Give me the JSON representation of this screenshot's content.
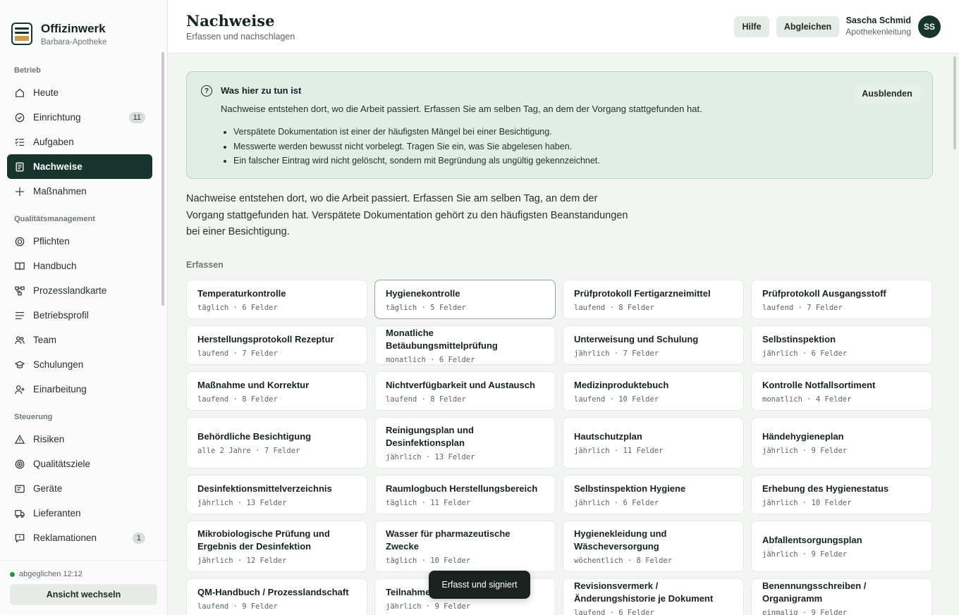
{
  "brand": {
    "name": "Offizinwerk",
    "pharmacy": "Barbara-Apotheke"
  },
  "nav": {
    "sections": [
      {
        "label": "Betrieb",
        "items": [
          {
            "label": "Heute",
            "icon": "home-icon"
          },
          {
            "label": "Einrichtung",
            "icon": "check-circle-icon",
            "badge": "11"
          },
          {
            "label": "Aufgaben",
            "icon": "checklist-icon"
          },
          {
            "label": "Nachweise",
            "icon": "document-icon",
            "active": true
          },
          {
            "label": "Maßnahmen",
            "icon": "plus-icon"
          }
        ]
      },
      {
        "label": "Qualitätsmanagement",
        "items": [
          {
            "label": "Pflichten",
            "icon": "target-icon"
          },
          {
            "label": "Handbuch",
            "icon": "book-icon"
          },
          {
            "label": "Prozesslandkarte",
            "icon": "flow-icon"
          },
          {
            "label": "Betriebsprofil",
            "icon": "lines-icon"
          },
          {
            "label": "Team",
            "icon": "users-icon"
          },
          {
            "label": "Schulungen",
            "icon": "graduation-cap-icon"
          },
          {
            "label": "Einarbeitung",
            "icon": "user-plus-icon"
          }
        ]
      },
      {
        "label": "Steuerung",
        "items": [
          {
            "label": "Risiken",
            "icon": "warning-icon"
          },
          {
            "label": "Qualitätsziele",
            "icon": "goal-icon"
          },
          {
            "label": "Geräte",
            "icon": "device-icon"
          },
          {
            "label": "Lieferanten",
            "icon": "truck-icon"
          },
          {
            "label": "Reklamationen",
            "icon": "message-icon",
            "badge": "1"
          }
        ]
      }
    ]
  },
  "footer": {
    "sync_status": "abgeglichen 12:12",
    "switch_view": "Ansicht wechseln"
  },
  "header": {
    "title": "Nachweise",
    "subtitle": "Erfassen und nachschlagen",
    "help": "Hilfe",
    "sync": "Abgleichen",
    "user_name": "Sascha Schmid",
    "user_role": "Apothekenleitung",
    "user_initials": "SS"
  },
  "info": {
    "title": "Was hier zu tun ist",
    "text": "Nachweise entstehen dort, wo die Arbeit passiert. Erfassen Sie am selben Tag, an dem der Vorgang stattgefunden hat.",
    "bullets": [
      "Verspätete Dokumentation ist einer der häufigsten Mängel bei einer Besichtigung.",
      "Messwerte werden bewusst nicht vorbelegt. Tragen Sie ein, was Sie abgelesen haben.",
      "Ein falscher Eintrag wird nicht gelöscht, sondern mit Begründung als ungültig gekennzeichnet."
    ],
    "hide": "Ausblenden"
  },
  "intro": "Nachweise entstehen dort, wo die Arbeit passiert. Erfassen Sie am selben Tag, an dem der Vorgang stattgefunden hat. Verspätete Dokumentation gehört zu den häufigsten Beanstandungen bei einer Besichtigung.",
  "section_label": "Erfassen",
  "cards": [
    {
      "title": "Temperaturkontrolle",
      "meta": "täglich · 6 Felder"
    },
    {
      "title": "Hygienekontrolle",
      "meta": "täglich · 5 Felder",
      "selected": true
    },
    {
      "title": "Prüfprotokoll Fertigarzneimittel",
      "meta": "laufend · 8 Felder"
    },
    {
      "title": "Prüfprotokoll Ausgangsstoff",
      "meta": "laufend · 7 Felder"
    },
    {
      "title": "Herstellungsprotokoll Rezeptur",
      "meta": "laufend · 7 Felder"
    },
    {
      "title": "Monatliche Betäubungsmittelprüfung",
      "meta": "monatlich · 6 Felder"
    },
    {
      "title": "Unterweisung und Schulung",
      "meta": "jährlich · 7 Felder"
    },
    {
      "title": "Selbstinspektion",
      "meta": "jährlich · 6 Felder"
    },
    {
      "title": "Maßnahme und Korrektur",
      "meta": "laufend · 8 Felder"
    },
    {
      "title": "Nichtverfügbarkeit und Austausch",
      "meta": "laufend · 8 Felder"
    },
    {
      "title": "Medizinproduktebuch",
      "meta": "laufend · 10 Felder"
    },
    {
      "title": "Kontrolle Notfallsortiment",
      "meta": "monatlich · 4 Felder"
    },
    {
      "title": "Behördliche Besichtigung",
      "meta": "alle 2 Jahre · 7 Felder"
    },
    {
      "title": "Reinigungsplan und Desinfektionsplan",
      "meta": "jährlich · 13 Felder"
    },
    {
      "title": "Hautschutzplan",
      "meta": "jährlich · 11 Felder"
    },
    {
      "title": "Händehygieneplan",
      "meta": "jährlich · 9 Felder"
    },
    {
      "title": "Desinfektionsmittelverzeichnis",
      "meta": "jährlich · 13 Felder"
    },
    {
      "title": "Raumlogbuch Herstellungsbereich",
      "meta": "täglich · 11 Felder"
    },
    {
      "title": "Selbstinspektion Hygiene",
      "meta": "jährlich · 6 Felder"
    },
    {
      "title": "Erhebung des Hygienestatus",
      "meta": "jährlich · 10 Felder"
    },
    {
      "title": "Mikrobiologische Prüfung und Ergebnis der Desinfektion",
      "meta": "jährlich · 12 Felder"
    },
    {
      "title": "Wasser für pharmazeutische Zwecke",
      "meta": "täglich · 10 Felder"
    },
    {
      "title": "Hygienekleidung und Wäscheversorgung",
      "meta": "wöchentlich · 8 Felder"
    },
    {
      "title": "Abfallentsorgungsplan",
      "meta": "jährlich · 9 Felder"
    },
    {
      "title": "QM-Handbuch / Prozesslandschaft",
      "meta": "laufend · 9 Felder"
    },
    {
      "title": "Teilnahme … Ergebnisbericht",
      "meta": "jährlich · 9 Felder"
    },
    {
      "title": "Revisionsvermerk / Änderungshistorie je Dokument",
      "meta": "laufend · 6 Felder"
    },
    {
      "title": "Benennungsschreiben / Organigramm",
      "meta": "einmalig · 9 Felder"
    }
  ],
  "toast": "Erfasst und signiert"
}
